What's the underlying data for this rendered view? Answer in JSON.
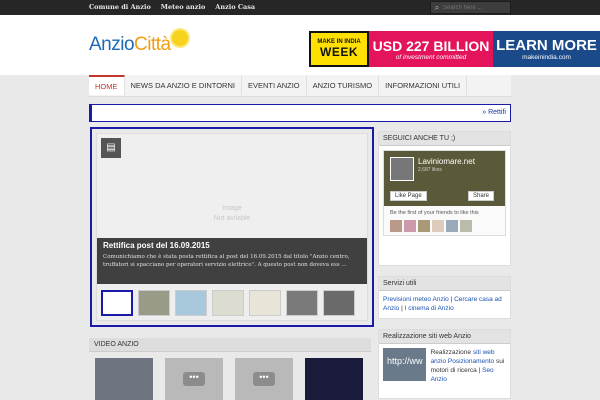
{
  "topbar": {
    "links": [
      "Comune di Anzio",
      "Meteo anzio",
      "Anzio Casa"
    ],
    "search_placeholder": "Search here ...",
    "search_icon": "search-icon"
  },
  "logo": {
    "part1": "Anzio",
    "part2": "Città"
  },
  "banner": {
    "make_small": "MAKE IN INDIA",
    "make_large": "WEEK",
    "amount": "USD 227 BILLION",
    "amount_sub": "of investment committed",
    "cta": "LEARN MORE",
    "cta_sub": "makeinindia.com"
  },
  "nav": {
    "items": [
      "HOME",
      "NEWS DA ANZIO E DINTORNI",
      "EVENTI ANZIO",
      "ANZIO TURISMO",
      "INFORMAZIONI UTILI"
    ]
  },
  "breadcrumb": {
    "current": "Rettifi"
  },
  "slider": {
    "placeholder_line1": "Image",
    "placeholder_line2": "Not avilable",
    "title": "Rettifica post del 16.09.2015",
    "excerpt": "Comunichiamo che è stata posta rettifica al post del 16.09.2015 dal titolo  \"Anzio centro, truffatori si spacciano per operatori servizio elettrico\".  A  questo post non doveva ess ..."
  },
  "video": {
    "heading": "VIDEO ANZIO"
  },
  "sidebar": {
    "follow_heading": "SEGUICI ANCHE TU ;)",
    "fb_name": "Laviniomare.net",
    "fb_likes": "2,687 likes",
    "fb_like_btn": "Like Page",
    "fb_share_btn": "Share",
    "fb_first": "Be the first of your friends to like this",
    "services_heading": "Servizi utili",
    "service_link1": "Previsioni meteo Anzio",
    "service_link2": "Cercare casa ad Anzio",
    "service_link3": "I cinema di Anzio",
    "sites_heading": "Realizzazione siti web Anzio",
    "sites_text1": "Realizzazione",
    "sites_link1": "siti web anzio",
    "sites_link2": "Posizionamento",
    "sites_text2": "sui motori di ricerca",
    "sites_link3": "Seo Anzio",
    "sites_img_text": "http://ww"
  }
}
